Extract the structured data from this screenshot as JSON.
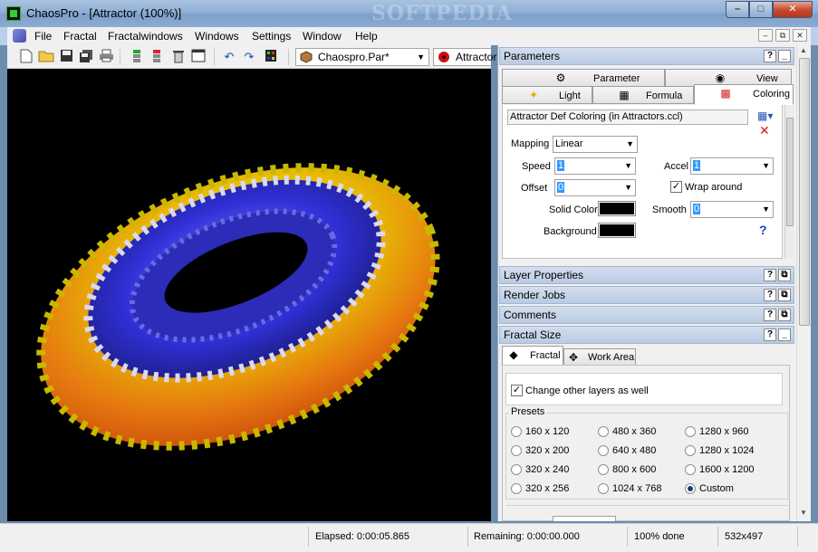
{
  "window": {
    "title": "ChaosPro - [Attractor (100%)]",
    "watermark": "SOFTPEDIA",
    "minimize": "–",
    "maximize": "□",
    "close": "✕"
  },
  "menu": [
    "File",
    "Fractal",
    "Fractalwindows",
    "Windows",
    "Settings",
    "Window",
    "Help"
  ],
  "mdi_buttons": {
    "minimize": "–",
    "restore": "⧉",
    "close": "✕"
  },
  "toolbar": {
    "param_combo": "Chaospro.Par*",
    "fractal_combo": "Attractor"
  },
  "parameters": {
    "header": "Parameters",
    "tabs_top": [
      {
        "label": "Parameter",
        "icon": "parameter-icon"
      },
      {
        "label": "View",
        "icon": "eye-icon"
      }
    ],
    "tabs_bottom": [
      {
        "label": "Light",
        "icon": "light-icon"
      },
      {
        "label": "Formula",
        "icon": "formula-icon"
      },
      {
        "label": "Coloring",
        "icon": "coloring-icon",
        "active": true
      }
    ],
    "coloring_name": "Attractor Def Coloring (in Attractors.ccl)",
    "mapping_label": "Mapping",
    "mapping_value": "Linear",
    "speed_label": "Speed",
    "speed_value": "1",
    "accel_label": "Accel",
    "accel_value": "1",
    "offset_label": "Offset",
    "offset_value": "0",
    "wrap_label": "Wrap around",
    "wrap_checked": true,
    "solid_color_label": "Solid Color",
    "solid_color": "#000000",
    "smooth_label": "Smooth",
    "smooth_value": "0",
    "background_label": "Background",
    "background_color": "#000000",
    "help": "?"
  },
  "sections": {
    "layer": "Layer Properties",
    "render": "Render Jobs",
    "comments": "Comments",
    "size": "Fractal Size"
  },
  "fractal_size": {
    "tabs": [
      "Fractal",
      "Work Area"
    ],
    "change_other": "Change other layers as well",
    "change_other_checked": true,
    "presets_label": "Presets",
    "presets": [
      [
        "160 x 120",
        "480 x 360",
        "1280 x 960"
      ],
      [
        "320 x 200",
        "640 x 480",
        "1280 x 1024"
      ],
      [
        "320 x 240",
        "800 x 600",
        "1600 x 1200"
      ],
      [
        "320 x 256",
        "1024 x 768",
        "Custom"
      ]
    ],
    "selected": "Custom"
  },
  "status": {
    "elapsed": "Elapsed: 0:00:05.865",
    "remaining": "Remaining: 0:00:00.000",
    "done": "100% done",
    "size": "532x497"
  },
  "colors": {
    "title_bar": "#8fb0d6",
    "panel_header": "#c6d5e8",
    "torus_outer": "#e8e000",
    "torus_mid": "#e05a10",
    "torus_inner": "#3a3ad8"
  }
}
